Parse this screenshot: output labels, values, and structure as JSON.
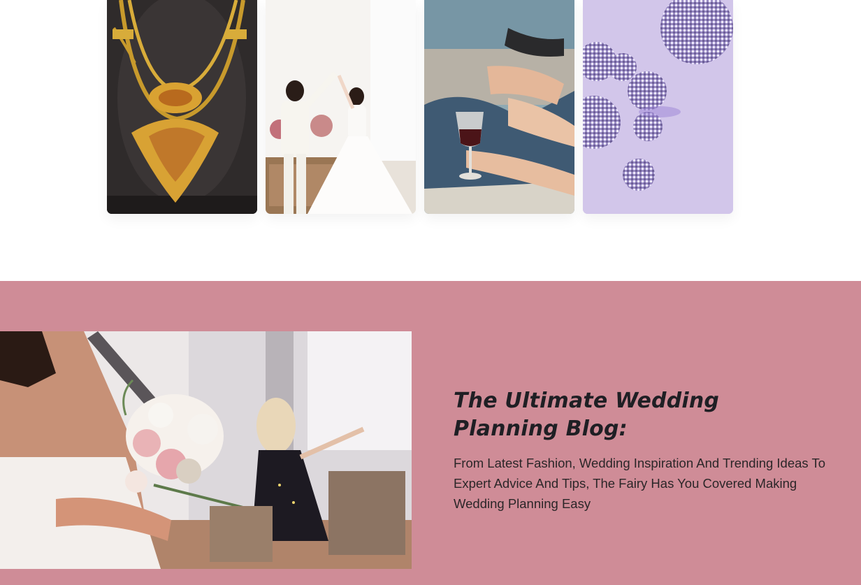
{
  "gallery": {
    "images": [
      {
        "alt": "gold-necklace-photo"
      },
      {
        "alt": "couple-dancing-photo"
      },
      {
        "alt": "beach-wine-glass-photo"
      },
      {
        "alt": "disco-balls-photo"
      }
    ]
  },
  "blog": {
    "title": "The Ultimate Wedding Planning Blog:",
    "description": "From Latest Fashion, Wedding Inspiration And Trending Ideas To Expert Advice And Tips, The Fairy Has You Covered Making Wedding Planning Easy",
    "image_alt": "bride-with-bouquet-photo"
  },
  "colors": {
    "section_background": "#cf8c97",
    "text": "#1f1f24",
    "page_background": "#ffffff"
  }
}
